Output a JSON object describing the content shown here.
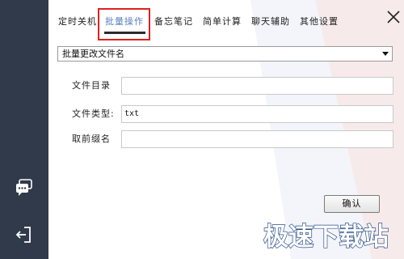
{
  "sidebar": {
    "icons": [
      {
        "name": "chat-bubbles-icon"
      },
      {
        "name": "exit-icon"
      }
    ]
  },
  "tabs": [
    {
      "label": "定时关机",
      "active": false
    },
    {
      "label": "批量操作",
      "active": true
    },
    {
      "label": "备忘笔记",
      "active": false
    },
    {
      "label": "简单计算",
      "active": false
    },
    {
      "label": "聊天辅助",
      "active": false
    },
    {
      "label": "其他设置",
      "active": false
    }
  ],
  "operation_select": {
    "value": "批量更改文件名"
  },
  "form": {
    "dir_label": "文件目录",
    "dir_value": "",
    "type_label": "文件类型:",
    "type_value": "txt",
    "prefix_label": "取前缀名",
    "prefix_value": ""
  },
  "confirm_button": {
    "label": "确认"
  },
  "watermark": {
    "text": "极速下载站"
  },
  "colors": {
    "sidebar_bg": "#313a4b",
    "active_tab": "#5a7fc0",
    "highlight_box": "#e02020"
  }
}
